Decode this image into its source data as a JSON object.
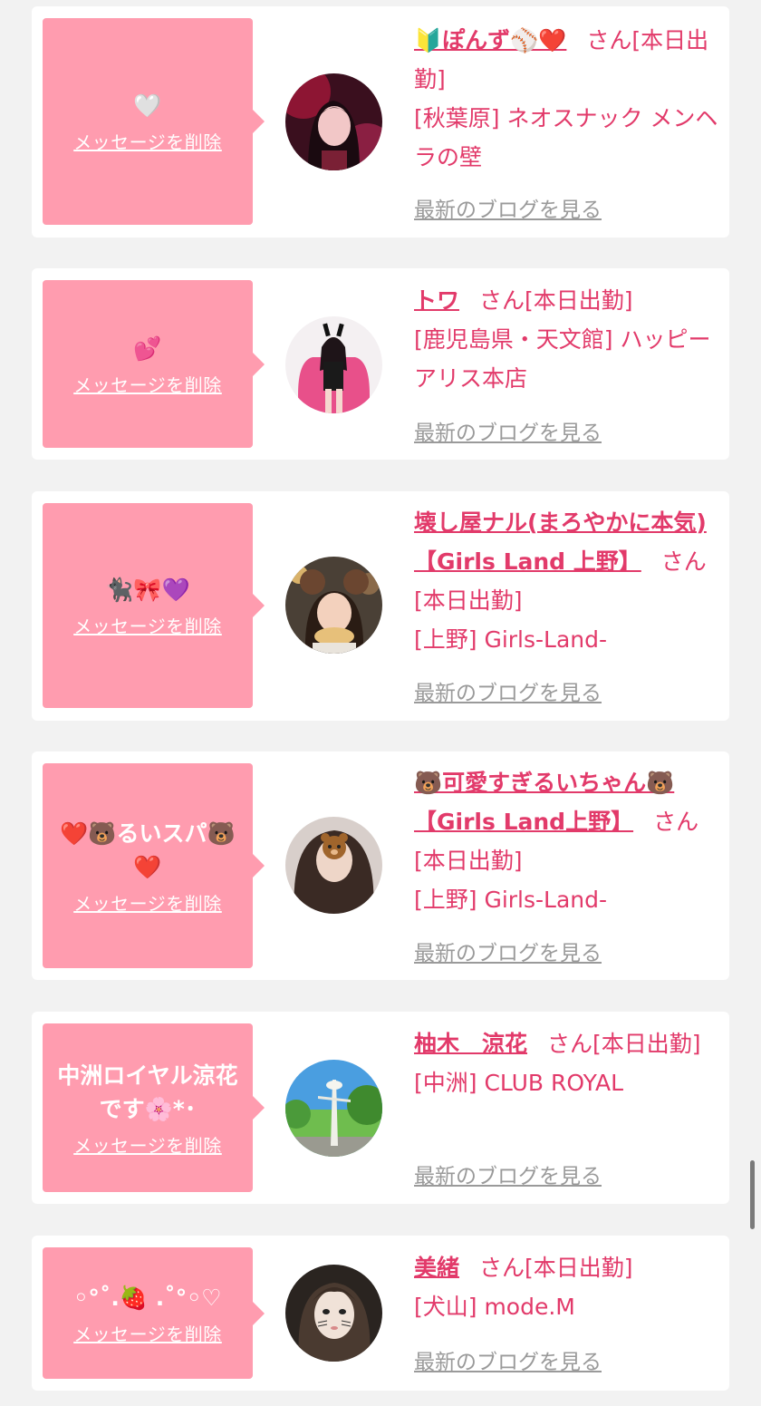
{
  "common": {
    "delete_label": "メッセージを削除",
    "blog_label": "最新のブログを見る",
    "san": "さん",
    "status": "[本日出勤]"
  },
  "cards": [
    {
      "message": "🤍",
      "name": "🔰ぽんず⚾️❤️",
      "area": "[秋葉原] ネオスナック メンヘラの壁",
      "avatar_icon": "girl-photo-red-lighting"
    },
    {
      "message": "💕",
      "name": "トワ",
      "area": "[鹿児島県・天文館] ハッピーアリス本店",
      "avatar_icon": "girl-photo-pink-chair"
    },
    {
      "message": "🐈‍⬛🎀💜",
      "name": "壊し屋ナル(まろやかに本気)【Girls Land 上野】",
      "area": "[上野] Girls-Land-",
      "avatar_icon": "girl-photo-bear-ears"
    },
    {
      "message": "❤️🐻るいスパ🐻❤️",
      "name": "🐻可愛すぎるいちゃん🐻【Girls Land上野】",
      "area": "[上野] Girls-Land-",
      "avatar_icon": "girl-photo-bear-face"
    },
    {
      "message": "中洲ロイヤル涼花です🌸*･",
      "name": "柚木　涼花",
      "area": "[中洲] CLUB ROYAL",
      "avatar_icon": "tower-photo"
    },
    {
      "message": "◦°˚.🍓 .˚°◦♡",
      "name": "美緒",
      "area": "[犬山] mode.M",
      "avatar_icon": "girl-photo-cat-filter"
    }
  ]
}
